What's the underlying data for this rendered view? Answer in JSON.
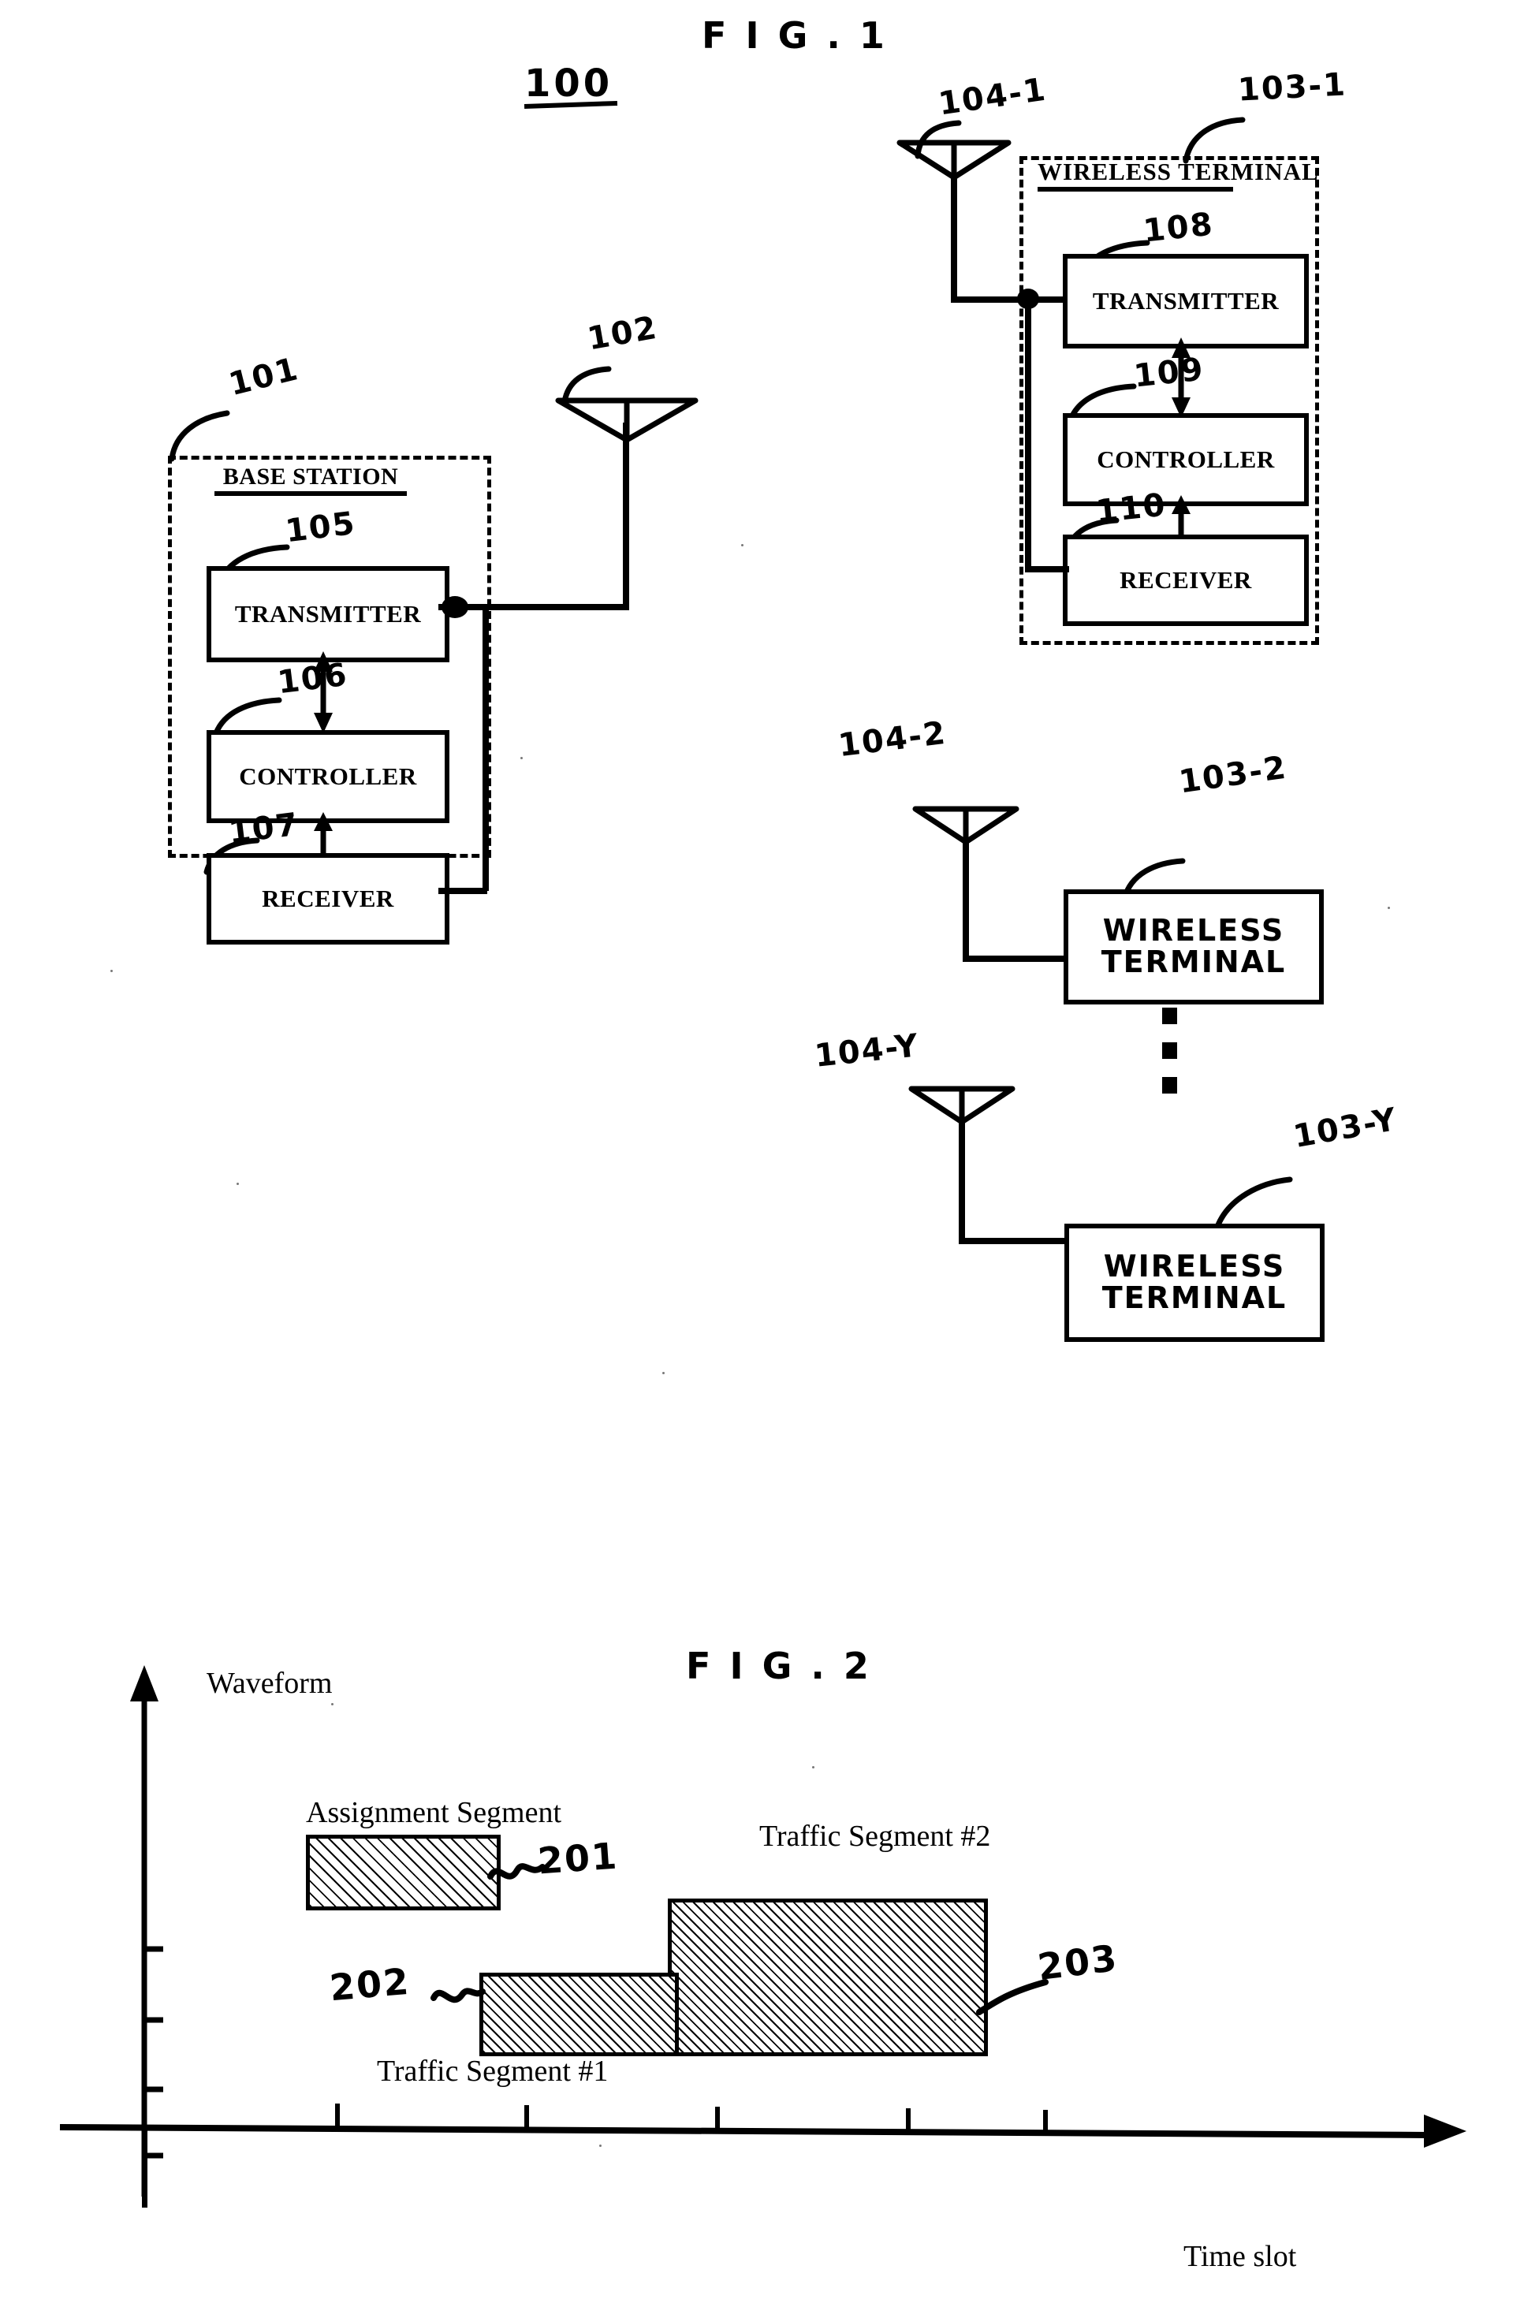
{
  "page": {
    "kind": "patent-drawing-sheet",
    "ink_color": "#000000",
    "paper_color": "#ffffff"
  },
  "figure1": {
    "title": "F I G . 1",
    "system_ref": "100",
    "base_station": {
      "ref": "101",
      "title": "BASE STATION",
      "antenna_ref": "102",
      "blocks": [
        {
          "ref": "105",
          "label": "TRANSMITTER"
        },
        {
          "ref": "106",
          "label": "CONTROLLER"
        },
        {
          "ref": "107",
          "label": "RECEIVER"
        }
      ]
    },
    "terminal_1": {
      "ref": "103-1",
      "title": "WIRELESS TERMINAL",
      "antenna_ref": "104-1",
      "blocks": [
        {
          "ref": "108",
          "label": "TRANSMITTER"
        },
        {
          "ref": "109",
          "label": "CONTROLLER"
        },
        {
          "ref": "110",
          "label": "RECEIVER"
        }
      ]
    },
    "terminal_2": {
      "ref": "103-2",
      "antenna_ref": "104-2",
      "label_line1": "WIRELESS",
      "label_line2": "TERMINAL"
    },
    "terminal_y": {
      "ref": "103-Y",
      "antenna_ref": "104-Y",
      "label_line1": "WIRELESS",
      "label_line2": "TERMINAL"
    },
    "ellipsis": "vertical-dots"
  },
  "figure2": {
    "title": "F I G . 2",
    "y_axis_label": "Waveform",
    "x_axis_label": "Time slot",
    "annotations": [
      {
        "ref": "201",
        "label": "Assignment Segment"
      },
      {
        "ref": "202",
        "label": "Traffic Segment #1"
      },
      {
        "ref": "203",
        "label": "Traffic Segment #2"
      }
    ]
  },
  "chart_data": {
    "type": "bar",
    "title": "F I G . 2",
    "xlabel": "Time slot",
    "ylabel": "Waveform",
    "grid": false,
    "legend": "none",
    "x_ticks": [
      1,
      2,
      3,
      4,
      5
    ],
    "y_ticks": [
      1,
      2,
      3,
      4
    ],
    "ylim": [
      0,
      5
    ],
    "xlim": [
      0,
      6
    ],
    "series": [
      {
        "name": "Assignment Segment",
        "ref": "201",
        "x_start": 1.0,
        "x_end": 2.0,
        "baseline": 2.55,
        "top": 3.45,
        "hatch": "diagonal-coarse"
      },
      {
        "name": "Traffic Segment #1",
        "ref": "202",
        "x_start": 2.0,
        "x_end": 3.0,
        "baseline": 0.65,
        "top": 1.55,
        "hatch": "diagonal-fine"
      },
      {
        "name": "Traffic Segment #2",
        "ref": "203",
        "x_start": 3.0,
        "x_end": 4.45,
        "baseline": 0.65,
        "top": 2.3,
        "hatch": "diagonal-fine"
      }
    ]
  }
}
